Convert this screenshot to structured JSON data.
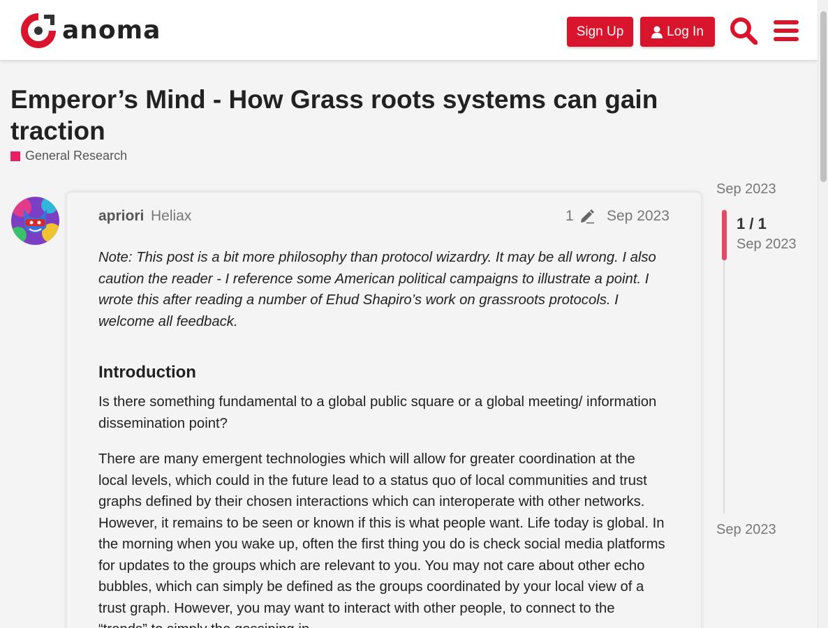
{
  "header": {
    "logo_text": "anoma",
    "signup_label": "Sign Up",
    "login_label": "Log In",
    "accent_color": "#d8152c"
  },
  "topic": {
    "title": "Emperor’s Mind - How Grass roots systems can gain traction",
    "category": "General Research",
    "category_color": "#e91e63"
  },
  "post": {
    "username": "apriori",
    "group": "Heliax",
    "edit_count": "1",
    "date": "Sep 2023",
    "note": "Note: This post is a bit more philosophy than protocol wizardry. It may be all wrong. I also caution the reader - I reference some American political campaigns to illustrate a point. I wrote this after reading a number of Ehud Shapiro’s work on grassroots protocols. I welcome all feedback.",
    "heading": "Introduction",
    "paragraph_1": "Is there something fundamental to a global public square or a global meeting/ information dissemination point?",
    "paragraph_2": "There are many emergent technologies which will allow for greater coordination at the local levels, which could in the future lead to a status quo of local communities and trust graphs defined by their chosen interactions which can interoperate with other networks. However, it remains to be seen or known if this is what people want. Life today is global. In the morning when you wake up, often the first thing you do is check social media platforms for updates to the groups which are relevant to you. You may not care about other echo bubbles, which can simply be defined as the groups coordinated by your local view of a trust graph. However, you may want to interact with other people, to connect to the “trends” to simply the gossiping in"
  },
  "timeline": {
    "start_date": "Sep 2023",
    "position": "1 / 1",
    "current_date": "Sep 2023",
    "end_date": "Sep 2023",
    "handle_color": "#e84867"
  },
  "icons": [
    "logo-mark-icon",
    "user-icon",
    "search-icon",
    "hamburger-menu-icon",
    "pencil-icon"
  ]
}
